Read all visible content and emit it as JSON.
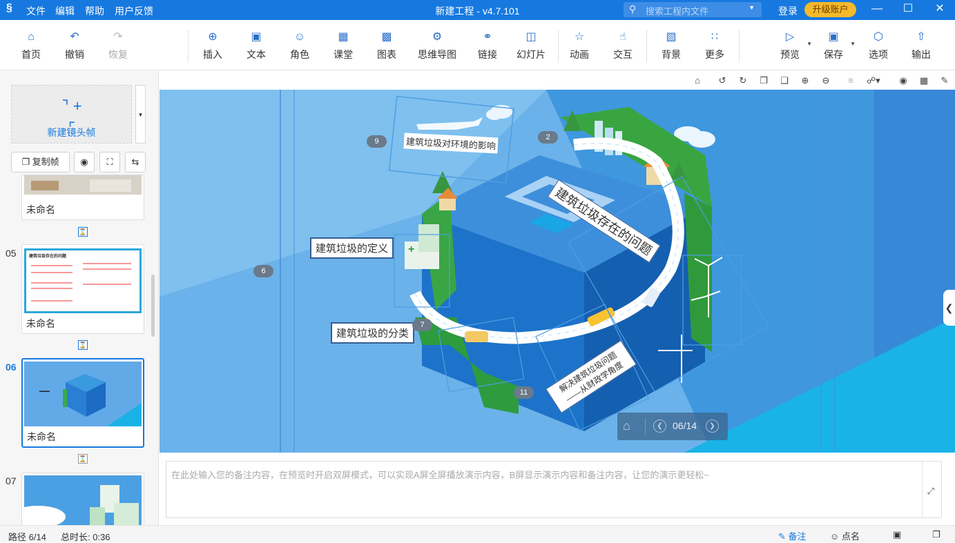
{
  "titlebar": {
    "logo": "§",
    "menus": [
      "文件",
      "编辑",
      "帮助",
      "用户反馈"
    ],
    "title": "新建工程 - v4.7.101",
    "search_placeholder": "搜索工程内文件",
    "login": "登录",
    "upgrade": "升级账户"
  },
  "toolbar": {
    "items": [
      {
        "label": "首页",
        "icon": "home-icon"
      },
      {
        "label": "撤销",
        "icon": "undo-icon"
      },
      {
        "label": "恢复",
        "icon": "redo-icon"
      },
      {
        "label": "插入",
        "icon": "plus-circle-icon"
      },
      {
        "label": "文本",
        "icon": "text-icon"
      },
      {
        "label": "角色",
        "icon": "user-icon"
      },
      {
        "label": "课堂",
        "icon": "classroom-icon"
      },
      {
        "label": "图表",
        "icon": "bar-chart-icon"
      },
      {
        "label": "思维导图",
        "icon": "mindmap-icon"
      },
      {
        "label": "链接",
        "icon": "link-icon"
      },
      {
        "label": "幻灯片",
        "icon": "slide-icon"
      },
      {
        "label": "动画",
        "icon": "star-icon"
      },
      {
        "label": "交互",
        "icon": "hand-icon"
      },
      {
        "label": "背景",
        "icon": "background-icon"
      },
      {
        "label": "更多",
        "icon": "grid-icon"
      },
      {
        "label": "预览",
        "icon": "preview-icon"
      },
      {
        "label": "保存",
        "icon": "save-icon"
      },
      {
        "label": "选项",
        "icon": "settings-icon"
      },
      {
        "label": "输出",
        "icon": "export-icon"
      }
    ]
  },
  "sidebar": {
    "new_frame": "新建镜头帧",
    "copy_frame": "复制帧",
    "frames": [
      {
        "no": "",
        "caption": "未命名"
      },
      {
        "no": "05",
        "caption": "未命名",
        "thumb_title": "建筑垃圾存在的问题"
      },
      {
        "no": "06",
        "caption": "未命名"
      },
      {
        "no": "07",
        "caption": ""
      }
    ]
  },
  "slide": {
    "labels": {
      "impact": "建筑垃圾对环境的影响",
      "problem": "建筑垃圾存在的问题",
      "definition": "建筑垃圾的定义",
      "classification": "建筑垃圾的分类",
      "solution_line1": "解决建筑垃圾问题",
      "solution_line2": "——从财政学角度"
    },
    "badges": [
      "9",
      "2",
      "6",
      "7",
      "11"
    ],
    "pager": "06/14"
  },
  "notes": {
    "placeholder": "在此处输入您的备注内容，在预览时开启双屏模式，可以实现A屏全屏播放演示内容，B屏显示演示内容和备注内容，让您的演示更轻松~"
  },
  "status": {
    "path": "路径 6/14",
    "duration": "总时长: 0:36",
    "notes_btn": "备注",
    "rollcall_btn": "点名"
  },
  "colors": {
    "brand": "#1779df",
    "upgrade": "#f5b92a",
    "canvas_bg": "#5da7e6"
  }
}
